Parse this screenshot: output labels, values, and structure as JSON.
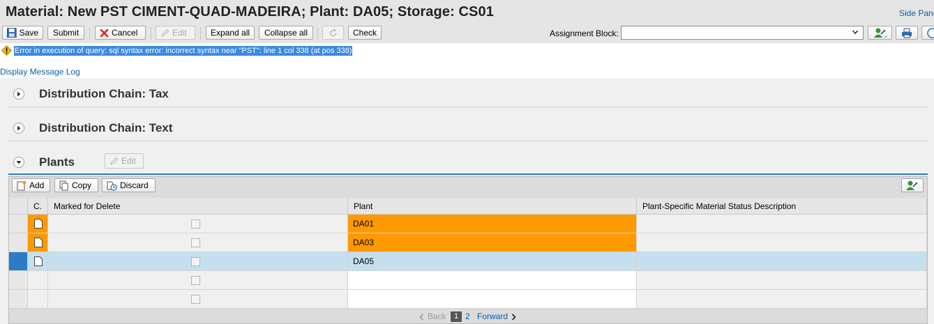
{
  "header": {
    "title": "Material: New PST CIMENT-QUAD-MADEIRA; Plant: DA05; Storage: CS01",
    "side_panel": "Side Panel"
  },
  "toolbar": {
    "save": "Save",
    "submit": "Submit",
    "cancel": "Cancel",
    "edit": "Edit",
    "expand_all": "Expand all",
    "collapse_all": "Collapse all",
    "check": "Check",
    "assignment_block_label": "Assignment Block:",
    "assignment_block_value": ""
  },
  "message": {
    "text": "Error in execution of query: sql syntax error: incorrect syntax near \"PST\": line 1 col 338 (at pos 338)",
    "log_link": "Display Message Log"
  },
  "sections": [
    {
      "title": "Distribution Chain: Tax",
      "expanded": false
    },
    {
      "title": "Distribution Chain: Text",
      "expanded": false
    },
    {
      "title": "Plants",
      "expanded": true,
      "edit_label": "Edit"
    }
  ],
  "plants_table": {
    "toolbar": {
      "add": "Add",
      "copy": "Copy",
      "discard": "Discard"
    },
    "columns": [
      "C.",
      "Marked for Delete",
      "Plant",
      "Plant-Specific Material Status Description"
    ],
    "rows": [
      {
        "plant": "DA01",
        "marked_for_delete": false,
        "status_description": "",
        "highlight": "orange"
      },
      {
        "plant": "DA03",
        "marked_for_delete": false,
        "status_description": "",
        "highlight": "orange"
      },
      {
        "plant": "DA05",
        "marked_for_delete": false,
        "status_description": "",
        "highlight": "selected"
      },
      {
        "plant": "",
        "marked_for_delete": false,
        "status_description": "",
        "highlight": "none"
      },
      {
        "plant": "",
        "marked_for_delete": false,
        "status_description": "",
        "highlight": "none"
      }
    ],
    "pager": {
      "back": "Back",
      "current_page": "1",
      "next_page": "2",
      "forward": "Forward"
    }
  },
  "colors": {
    "highlight_orange": "#ff9900",
    "selected_row": "#c5dfee",
    "selected_marker": "#2b7cc4",
    "link": "#0a5ea8",
    "message_highlight": "#3b8ae0"
  },
  "icons": [
    "save-icon",
    "cancel-icon",
    "pencil-icon",
    "refresh-icon",
    "settings-person-icon",
    "print-icon",
    "help-icon",
    "warning-icon",
    "expand-icon",
    "collapse-icon",
    "document-icon",
    "add-icon",
    "copy-icon",
    "discard-icon",
    "chevron-left-icon",
    "chevron-right-icon"
  ]
}
